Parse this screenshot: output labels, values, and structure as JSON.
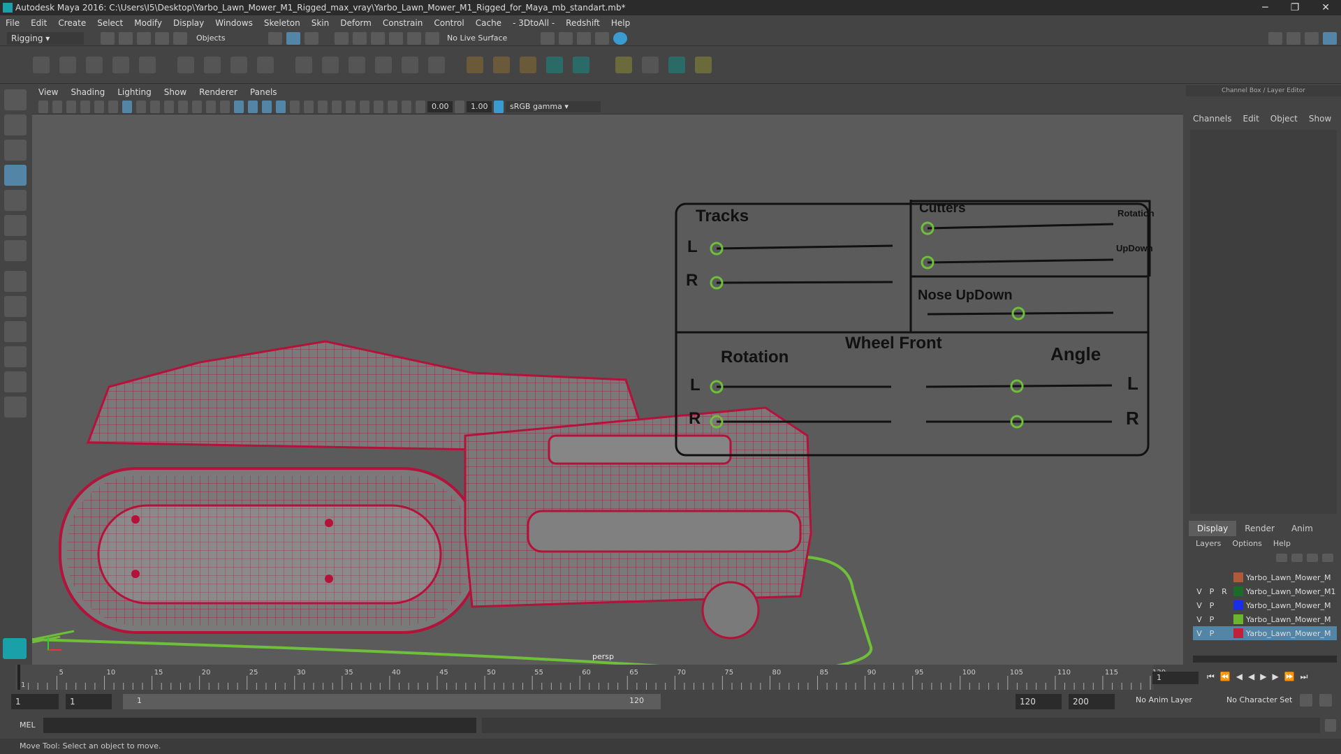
{
  "window": {
    "title": "Autodesk Maya 2016: C:\\Users\\I5\\Desktop\\Yarbo_Lawn_Mower_M1_Rigged_max_vray\\Yarbo_Lawn_Mower_M1_Rigged_for_Maya_mb_standart.mb*",
    "minimize": "─",
    "restore": "❐",
    "close": "✕"
  },
  "menu": [
    "File",
    "Edit",
    "Create",
    "Select",
    "Modify",
    "Display",
    "Windows",
    "Skeleton",
    "Skin",
    "Deform",
    "Constrain",
    "Control",
    "Cache",
    "- 3DtoAll -",
    "Redshift",
    "Help"
  ],
  "status": {
    "mode": "Rigging",
    "selection": "Objects",
    "live_surface": "No Live Surface"
  },
  "viewport": {
    "menu": [
      "View",
      "Shading",
      "Lighting",
      "Show",
      "Renderer",
      "Panels"
    ],
    "near": "0.00",
    "far": "1.00",
    "color_space": "sRGB gamma",
    "camera": "persp",
    "controls": {
      "tracks": "Tracks",
      "L": "L",
      "R": "R",
      "cutters": "Cutters",
      "rotation_small": "Rotation",
      "updown_small": "UpDown",
      "nose": "Nose UpDown",
      "wheel_front": "Wheel Front",
      "rotation": "Rotation",
      "angle": "Angle"
    }
  },
  "channel_box": {
    "header": "Channel Box / Layer Editor",
    "menu": [
      "Channels",
      "Edit",
      "Object",
      "Show"
    ]
  },
  "layer_editor": {
    "tabs": [
      "Display",
      "Render",
      "Anim"
    ],
    "menu": [
      "Layers",
      "Options",
      "Help"
    ],
    "layers": [
      {
        "v": "",
        "p": "",
        "r": "",
        "color": "#b05a3c",
        "name": "Yarbo_Lawn_Mower_M"
      },
      {
        "v": "V",
        "p": "P",
        "r": "R",
        "color": "#1d6b2a",
        "name": "Yarbo_Lawn_Mower_M1"
      },
      {
        "v": "V",
        "p": "P",
        "r": "",
        "color": "#1a2ee8",
        "name": "Yarbo_Lawn_Mower_M"
      },
      {
        "v": "V",
        "p": "P",
        "r": "",
        "color": "#6ab430",
        "name": "Yarbo_Lawn_Mower_M"
      },
      {
        "v": "V",
        "p": "P",
        "r": "",
        "color": "#c0203a",
        "name": "Yarbo_Lawn_Mower_M"
      }
    ]
  },
  "timeline": {
    "ticks": [
      "1",
      "5",
      "10",
      "15",
      "20",
      "25",
      "30",
      "35",
      "40",
      "45",
      "50",
      "55",
      "60",
      "65",
      "70",
      "75",
      "80",
      "85",
      "90",
      "95",
      "100",
      "105",
      "110",
      "115",
      "120"
    ],
    "current": "1"
  },
  "range": {
    "start": "1",
    "anim_start": "1",
    "slider_start": "1",
    "slider_end": "120",
    "end": "120",
    "anim_end": "200",
    "anim_layer": "No Anim Layer",
    "char_set": "No Character Set"
  },
  "cmd": {
    "label": "MEL"
  },
  "help_line": "Move Tool: Select an object to move."
}
